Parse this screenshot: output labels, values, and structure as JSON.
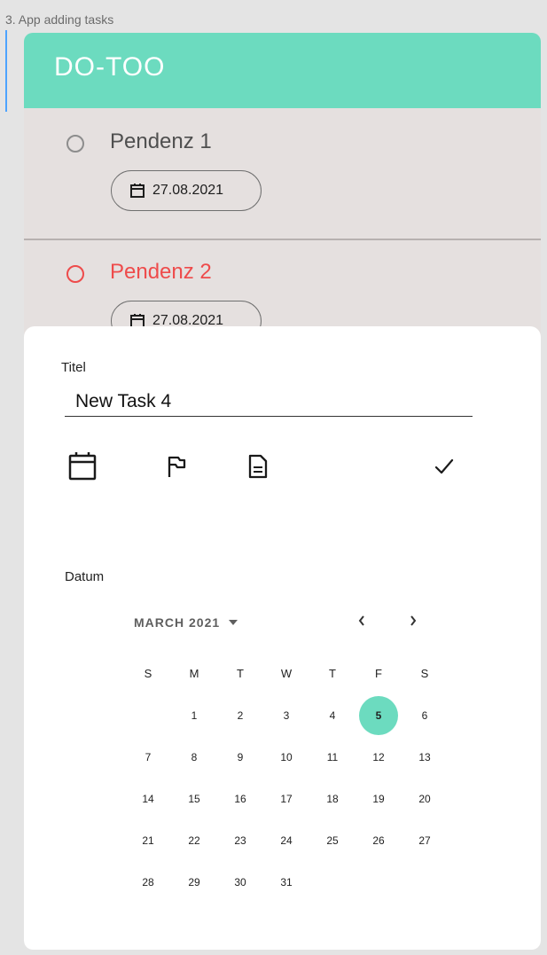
{
  "frame": {
    "label": "3. App adding tasks"
  },
  "app": {
    "title": "DO-TOO"
  },
  "tasks": [
    {
      "title": "Pendenz 1",
      "date": "27.08.2021",
      "overdue": false
    },
    {
      "title": "Pendenz 2",
      "date": "27.08.2021",
      "overdue": true
    }
  ],
  "colors": {
    "accent": "#6cdbbf",
    "overdue": "#ee4b4b",
    "list_bg": "#e5e0df"
  },
  "sheet": {
    "title_label": "Titel",
    "title_value": "New Task 4",
    "tools": [
      "calendar-icon",
      "flag-icon",
      "document-icon",
      "check-icon"
    ],
    "date_label": "Datum"
  },
  "calendar": {
    "month_label": "MARCH 2021",
    "weekdays": [
      "S",
      "M",
      "T",
      "W",
      "T",
      "F",
      "S"
    ],
    "leading_blanks": 1,
    "days": [
      "1",
      "2",
      "3",
      "4",
      "5",
      "6",
      "7",
      "8",
      "9",
      "10",
      "11",
      "12",
      "13",
      "14",
      "15",
      "16",
      "17",
      "18",
      "19",
      "20",
      "21",
      "22",
      "23",
      "24",
      "25",
      "26",
      "27",
      "28",
      "29",
      "30",
      "31"
    ],
    "selected_day": "5"
  }
}
